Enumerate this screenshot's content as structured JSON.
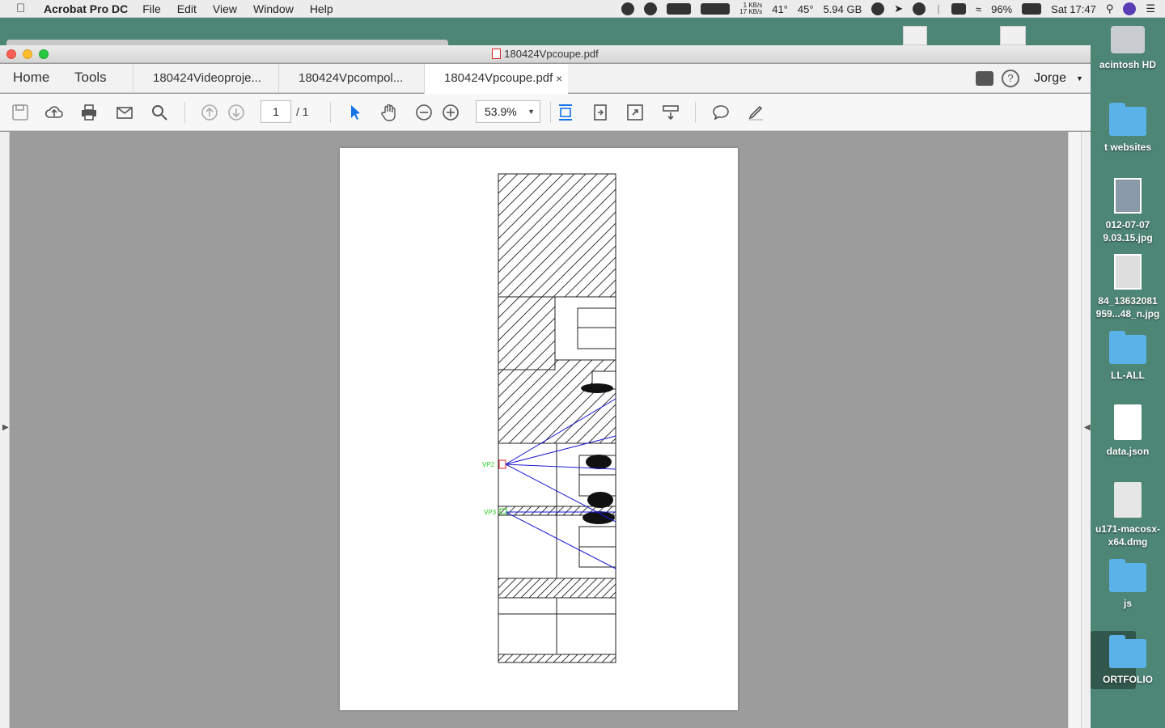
{
  "menubar": {
    "app_name": "Acrobat Pro DC",
    "menus": [
      "File",
      "Edit",
      "View",
      "Window",
      "Help"
    ],
    "net_up": "1 KB/s",
    "net_down": "17 KB/s",
    "temp1": "41°",
    "temp2": "45°",
    "disk_free": "5.94 GB",
    "battery": "96%",
    "clock": "Sat 17:47"
  },
  "window": {
    "title": "180424Vpcoupe.pdf"
  },
  "tabs": {
    "home": "Home",
    "tools": "Tools",
    "documents": [
      {
        "label": "180424Videoproje..."
      },
      {
        "label": "180424Vpcompol..."
      },
      {
        "label": "180424Vpcoupe.pdf"
      }
    ],
    "close_symbol": "×",
    "user": "Jorge",
    "help_symbol": "?"
  },
  "toolbar": {
    "page_current": "1",
    "page_total": "/ 1",
    "zoom": "53.9%"
  },
  "document": {
    "labels": [
      "VP2",
      "VP3"
    ]
  },
  "desktop": {
    "items": [
      {
        "label": "acintosh HD",
        "kind": "drive"
      },
      {
        "label": "t websites",
        "kind": "folder"
      },
      {
        "label": "012-07-07",
        "label2": "9.03.15.jpg",
        "kind": "image"
      },
      {
        "label": "84_13632081",
        "label2": "959...48_n.jpg",
        "kind": "image"
      },
      {
        "label": "LL-ALL",
        "kind": "folder"
      },
      {
        "label": "data.json",
        "kind": "doc"
      },
      {
        "label": "u171-macosx-",
        "label2": "x64.dmg",
        "kind": "dmg"
      },
      {
        "label": "js",
        "kind": "folder"
      },
      {
        "label": "ORTFOLIO",
        "kind": "folder"
      }
    ]
  },
  "colors": {
    "desktop": "#4e8676",
    "viewer": "#9c9c9c",
    "accent": "#1473e6",
    "sight_lines": "#1a1ad6",
    "vp_label": "#27d227",
    "vp_marker": "#e02020"
  }
}
